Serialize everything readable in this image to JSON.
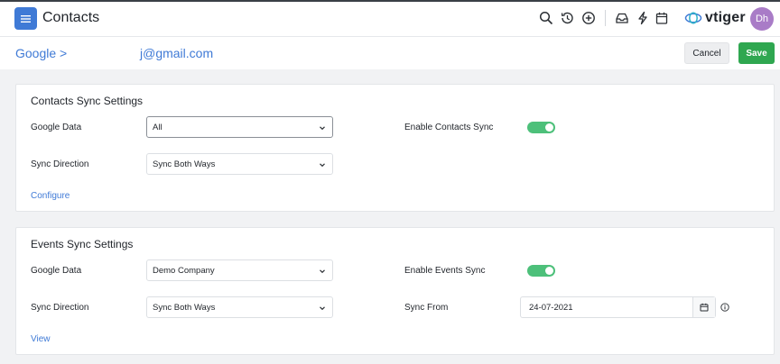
{
  "header": {
    "title": "Contacts",
    "brand": "vtiger",
    "avatar_initials": "Dh",
    "icons": [
      "search-icon",
      "history-icon",
      "add-circle-icon",
      "inbox-icon",
      "bolt-icon",
      "calendar-icon"
    ]
  },
  "subheader": {
    "breadcrumb": "Google >",
    "account": "j@gmail.com",
    "cancel_label": "Cancel",
    "save_label": "Save"
  },
  "contacts_sync": {
    "title": "Contacts Sync Settings",
    "google_data_label": "Google Data",
    "google_data_value": "All",
    "sync_direction_label": "Sync Direction",
    "sync_direction_value": "Sync Both Ways",
    "enable_label": "Enable Contacts Sync",
    "enabled": true,
    "link_label": "Configure"
  },
  "events_sync": {
    "title": "Events Sync Settings",
    "google_data_label": "Google Data",
    "google_data_value": "Demo Company",
    "sync_direction_label": "Sync Direction",
    "sync_direction_value": "Sync Both Ways",
    "enable_label": "Enable Events Sync",
    "enabled": true,
    "sync_from_label": "Sync From",
    "sync_from_value": "24-07-2021",
    "link_label": "View"
  },
  "colors": {
    "accent": "#3f7ad6",
    "save": "#2fa750",
    "toggle_on": "#4dc07a",
    "avatar": "#a97cc7"
  }
}
